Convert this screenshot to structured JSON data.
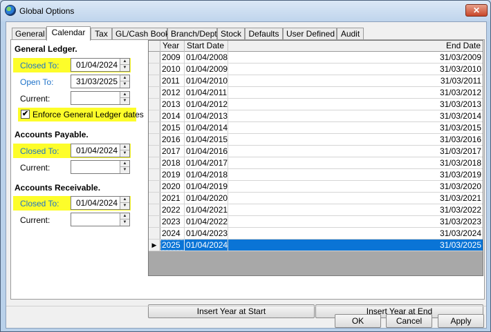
{
  "window": {
    "title": "Global Options",
    "close_label": "✕"
  },
  "tabs": [
    {
      "label": "General"
    },
    {
      "label": "Calendar"
    },
    {
      "label": "Tax"
    },
    {
      "label": "GL/Cash Book"
    },
    {
      "label": "Branch/Dept"
    },
    {
      "label": "Stock"
    },
    {
      "label": "Defaults"
    },
    {
      "label": "User Defined"
    },
    {
      "label": "Audit"
    }
  ],
  "general_ledger": {
    "title": "General Ledger.",
    "closed_to_label": "Closed To:",
    "closed_to_value": "01/04/2024",
    "open_to_label": "Open To:",
    "open_to_value": "31/03/2025",
    "current_label": "Current:",
    "current_value": "",
    "enforce_label": "Enforce General Ledger dates",
    "enforce_checked": "✔"
  },
  "accounts_payable": {
    "title": "Accounts Payable.",
    "closed_to_label": "Closed To:",
    "closed_to_value": "01/04/2024",
    "current_label": "Current:",
    "current_value": ""
  },
  "accounts_receivable": {
    "title": "Accounts Receivable.",
    "closed_to_label": "Closed To:",
    "closed_to_value": "01/04/2024",
    "current_label": "Current:",
    "current_value": ""
  },
  "grid": {
    "columns": [
      "Year",
      "Start Date",
      "End Date"
    ],
    "rows": [
      [
        "2009",
        "01/04/2008",
        "31/03/2009"
      ],
      [
        "2010",
        "01/04/2009",
        "31/03/2010"
      ],
      [
        "2011",
        "01/04/2010",
        "31/03/2011"
      ],
      [
        "2012",
        "01/04/2011",
        "31/03/2012"
      ],
      [
        "2013",
        "01/04/2012",
        "31/03/2013"
      ],
      [
        "2014",
        "01/04/2013",
        "31/03/2014"
      ],
      [
        "2015",
        "01/04/2014",
        "31/03/2015"
      ],
      [
        "2016",
        "01/04/2015",
        "31/03/2016"
      ],
      [
        "2017",
        "01/04/2016",
        "31/03/2017"
      ],
      [
        "2018",
        "01/04/2017",
        "31/03/2018"
      ],
      [
        "2019",
        "01/04/2018",
        "31/03/2019"
      ],
      [
        "2020",
        "01/04/2019",
        "31/03/2020"
      ],
      [
        "2021",
        "01/04/2020",
        "31/03/2021"
      ],
      [
        "2022",
        "01/04/2021",
        "31/03/2022"
      ],
      [
        "2023",
        "01/04/2022",
        "31/03/2023"
      ],
      [
        "2024",
        "01/04/2023",
        "31/03/2024"
      ],
      [
        "2025",
        "01/04/2024",
        "31/03/2025"
      ]
    ],
    "selected_row_marker": "▶",
    "insert_start_label": "Insert Year at Start",
    "insert_end_label": "Insert Year at End"
  },
  "footer": {
    "ok_label": "OK",
    "cancel_label": "Cancel",
    "apply_label": "Apply"
  },
  "colors": {
    "highlight": "#fdfd2a",
    "selection": "#0a74d6",
    "link_label": "#1e72c8"
  }
}
